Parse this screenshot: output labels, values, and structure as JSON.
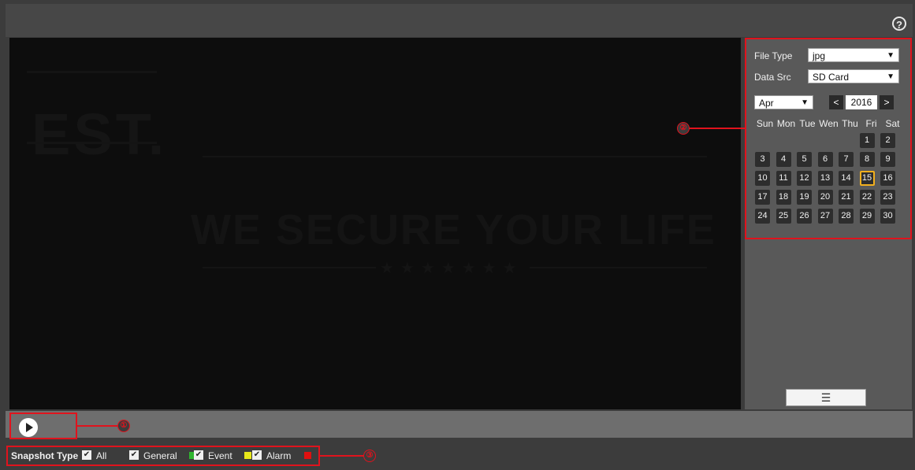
{
  "header": {
    "help_icon": "help-icon",
    "help_glyph": "?"
  },
  "video": {
    "watermark_est": "EST.",
    "watermark_motto": "WE SECURE YOUR LIFE",
    "watermark_stars": "★★★★★★★"
  },
  "search": {
    "file_type_label": "File Type",
    "file_type_value": "jpg",
    "data_src_label": "Data Src",
    "data_src_value": "SD Card"
  },
  "calendar": {
    "month": "Apr",
    "year": "2016",
    "prev_glyph": "<",
    "next_glyph": ">",
    "weekdays": [
      "Sun",
      "Mon",
      "Tue",
      "Wen",
      "Thu",
      "Fri",
      "Sat"
    ],
    "days": [
      "1",
      "2",
      "3",
      "4",
      "5",
      "6",
      "7",
      "8",
      "9",
      "10",
      "11",
      "12",
      "13",
      "14",
      "15",
      "16",
      "17",
      "18",
      "19",
      "20",
      "21",
      "22",
      "23",
      "24",
      "25",
      "26",
      "27",
      "28",
      "29",
      "30"
    ],
    "selected_day": "15",
    "list_button_icon": "list-icon"
  },
  "playback": {
    "play_icon": "play-icon"
  },
  "snapshot": {
    "label": "Snapshot Type",
    "options": [
      {
        "label": "All",
        "checked": true
      },
      {
        "label": "General",
        "checked": true,
        "color": "#2fb52f"
      },
      {
        "label": "Event",
        "checked": true,
        "color": "#e8e81a"
      },
      {
        "label": "Alarm",
        "checked": true,
        "color": "#e01010"
      }
    ]
  },
  "callouts": [
    "①",
    "②",
    "③"
  ],
  "colors": {
    "highlight": "#e0131d",
    "selected_day_border": "#f2b01e"
  }
}
